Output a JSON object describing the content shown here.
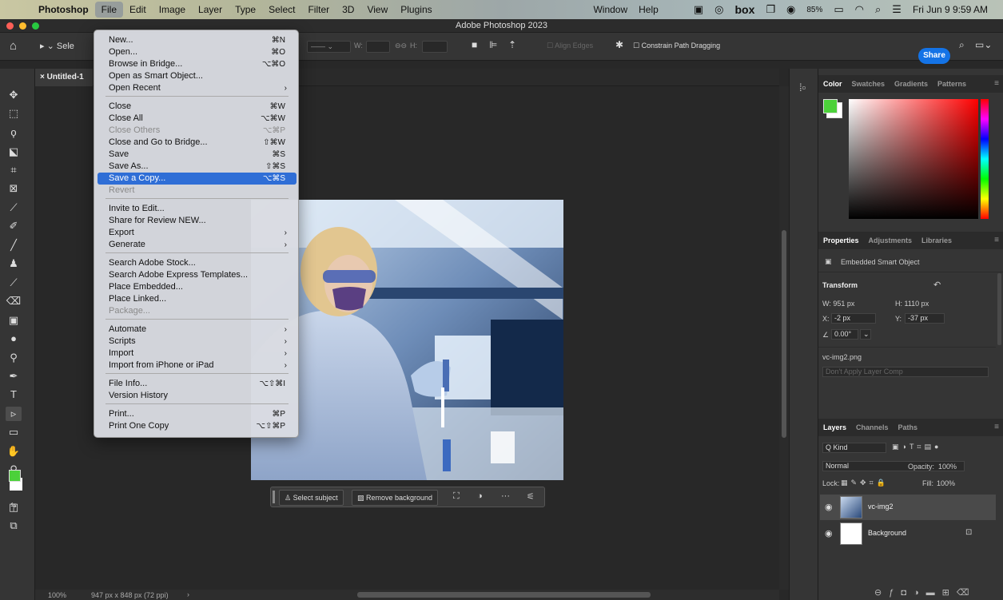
{
  "menubar": {
    "app": "Photoshop",
    "items": [
      "File",
      "Edit",
      "Image",
      "Layer",
      "Type",
      "Select",
      "Filter",
      "3D",
      "View",
      "Plugins"
    ],
    "right_items": [
      "Window",
      "Help"
    ],
    "box_label": "box",
    "battery": "85%",
    "clock": "Fri Jun 9  9:59 AM"
  },
  "window": {
    "title": "Adobe Photoshop 2023"
  },
  "optionsbar": {
    "tool_label": "Sele",
    "w_label": "W:",
    "h_label": "H:",
    "align_edges": "Align Edges",
    "constrain": "Constrain Path Dragging",
    "share": "Share"
  },
  "document": {
    "tab_title": "Untitled-1"
  },
  "file_menu": {
    "items": [
      {
        "label": "New...",
        "shortcut": "⌘N"
      },
      {
        "label": "Open...",
        "shortcut": "⌘O"
      },
      {
        "label": "Browse in Bridge...",
        "shortcut": "⌥⌘O"
      },
      {
        "label": "Open as Smart Object...",
        "shortcut": ""
      },
      {
        "label": "Open Recent",
        "shortcut": "",
        "submenu": true
      },
      {
        "label": "Close",
        "shortcut": "⌘W"
      },
      {
        "label": "Close All",
        "shortcut": "⌥⌘W"
      },
      {
        "label": "Close Others",
        "shortcut": "⌥⌘P",
        "disabled": true
      },
      {
        "label": "Close and Go to Bridge...",
        "shortcut": "⇧⌘W"
      },
      {
        "label": "Save",
        "shortcut": "⌘S"
      },
      {
        "label": "Save As...",
        "shortcut": "⇧⌘S"
      },
      {
        "label": "Save a Copy...",
        "shortcut": "⌥⌘S",
        "highlight": true
      },
      {
        "label": "Revert",
        "shortcut": "",
        "disabled": true
      },
      {
        "label": "Invite to Edit...",
        "shortcut": ""
      },
      {
        "label": "Share for Review NEW...",
        "shortcut": ""
      },
      {
        "label": "Export",
        "shortcut": "",
        "submenu": true
      },
      {
        "label": "Generate",
        "shortcut": "",
        "submenu": true
      },
      {
        "label": "Search Adobe Stock...",
        "shortcut": ""
      },
      {
        "label": "Search Adobe Express Templates...",
        "shortcut": ""
      },
      {
        "label": "Place Embedded...",
        "shortcut": ""
      },
      {
        "label": "Place Linked...",
        "shortcut": ""
      },
      {
        "label": "Package...",
        "shortcut": "",
        "disabled": true
      },
      {
        "label": "Automate",
        "shortcut": "",
        "submenu": true
      },
      {
        "label": "Scripts",
        "shortcut": "",
        "submenu": true
      },
      {
        "label": "Import",
        "shortcut": "",
        "submenu": true
      },
      {
        "label": "Import from iPhone or iPad",
        "shortcut": "",
        "submenu": true
      },
      {
        "label": "File Info...",
        "shortcut": "⌥⇧⌘I"
      },
      {
        "label": "Version History",
        "shortcut": ""
      },
      {
        "label": "Print...",
        "shortcut": "⌘P"
      },
      {
        "label": "Print One Copy",
        "shortcut": "⌥⇧⌘P"
      }
    ]
  },
  "taskbar": {
    "select_subject": "Select subject",
    "remove_background": "Remove background",
    "more": "···"
  },
  "statusbar": {
    "zoom": "100%",
    "doc_info": "947 px x 848 px (72 ppi)"
  },
  "color_panel": {
    "tabs": [
      "Color",
      "Swatches",
      "Gradients",
      "Patterns"
    ],
    "foreground": "#4cd13a",
    "hue_base": "#ff0000"
  },
  "properties_panel": {
    "tabs": [
      "Properties",
      "Adjustments",
      "Libraries"
    ],
    "object_type": "Embedded Smart Object",
    "transform_label": "Transform",
    "w": "W: 951 px",
    "h": "H: 1110 px",
    "x_label": "X:",
    "x": "-2 px",
    "y_label": "Y:",
    "y": "-37 px",
    "angle": "0.00°",
    "filename": "vc-img2.png",
    "layer_comp": "Don't Apply Layer Comp"
  },
  "layers_panel": {
    "tabs": [
      "Layers",
      "Channels",
      "Paths"
    ],
    "filter": "Q Kind",
    "blend_mode": "Normal",
    "opacity_label": "Opacity:",
    "opacity": "100%",
    "lock_label": "Lock:",
    "fill_label": "Fill:",
    "fill": "100%",
    "layers": [
      {
        "name": "vc-img2",
        "selected": true
      },
      {
        "name": "Background",
        "locked": true
      }
    ]
  }
}
